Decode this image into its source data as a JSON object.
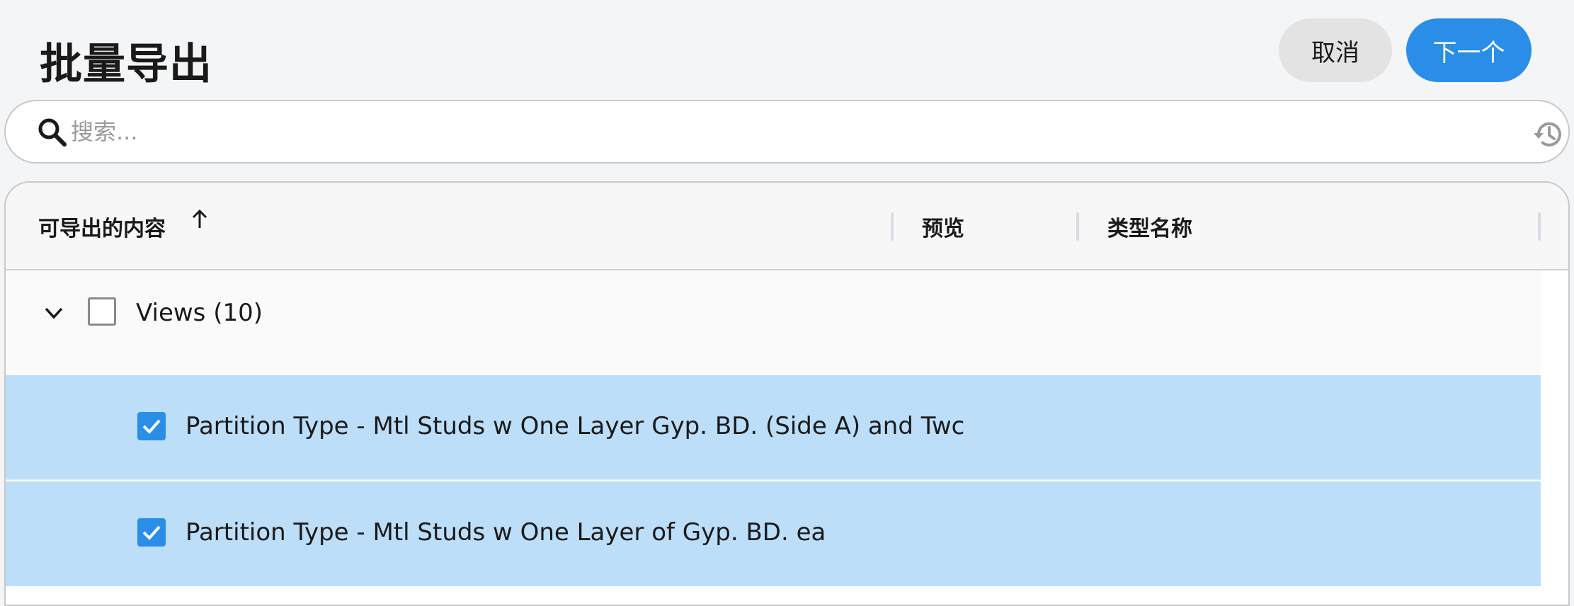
{
  "header": {
    "title": "批量导出",
    "cancel_label": "取消",
    "next_label": "下一个"
  },
  "search": {
    "placeholder": "搜索...",
    "value": ""
  },
  "table": {
    "columns": [
      "可导出的内容",
      "预览",
      "类型名称"
    ],
    "sort_column": "可导出的内容",
    "sort_direction": "ascending",
    "group": {
      "label": "Views (10)",
      "expanded": true,
      "checked": false
    },
    "rows": [
      {
        "label": "Partition Type - Mtl Studs w One Layer Gyp. BD. (Side A) and Twc",
        "checked": true
      },
      {
        "label": "Partition Type - Mtl Studs w One Layer of Gyp. BD. ea",
        "checked": true
      }
    ]
  },
  "colors": {
    "accent": "#2a8ee8",
    "selected_row": "#bcdef8",
    "cancel_bg": "#e3e3e3"
  },
  "icons": [
    "search-icon",
    "history-icon",
    "sort-ascending-icon",
    "chevron-down-icon",
    "checkmark-icon"
  ]
}
